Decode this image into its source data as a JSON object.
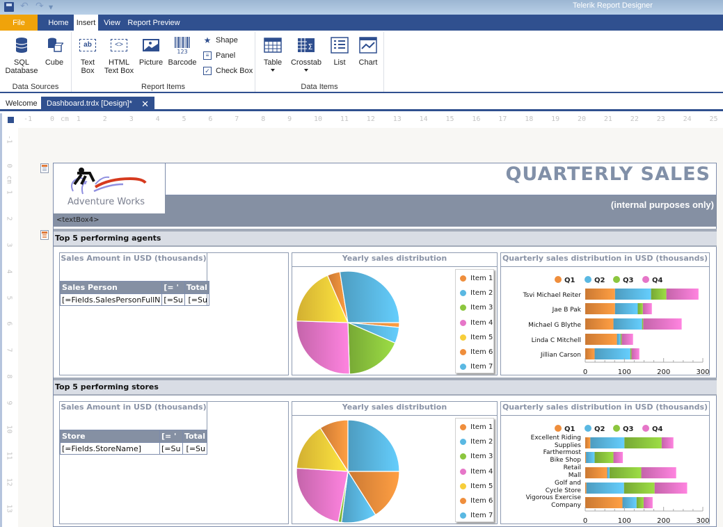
{
  "app": {
    "title": "Telerik Report Designer"
  },
  "quick_access": {
    "save": "save-icon",
    "undo": "undo-icon",
    "redo": "redo-icon",
    "more": "customize-dropdown"
  },
  "ribbon": {
    "tabs": [
      {
        "label": "File"
      },
      {
        "label": "Home"
      },
      {
        "label": "Insert"
      },
      {
        "label": "View"
      },
      {
        "label": "Report Preview"
      }
    ],
    "active_tab": "Insert",
    "groups": {
      "data_sources": {
        "label": "Data Sources",
        "buttons": [
          {
            "label1": "SQL",
            "label2": "Database"
          },
          {
            "label1": "Cube",
            "label2": ""
          }
        ]
      },
      "report_items": {
        "label": "Report Items",
        "buttons": [
          {
            "label1": "Text",
            "label2": "Box"
          },
          {
            "label1": "HTML",
            "label2": "Text Box"
          },
          {
            "label1": "Picture",
            "label2": ""
          },
          {
            "label1": "Barcode",
            "label2": ""
          }
        ],
        "small_buttons": [
          {
            "label": "Shape"
          },
          {
            "label": "Panel"
          },
          {
            "label": "Check Box"
          }
        ],
        "textbox_glyph": "ab",
        "html_glyph": "<>",
        "barcode_glyph": "123"
      },
      "data_items": {
        "label": "Data Items",
        "buttons": [
          {
            "label": "Table"
          },
          {
            "label": "Crosstab"
          },
          {
            "label": "List"
          },
          {
            "label": "Chart"
          }
        ]
      }
    }
  },
  "doc_tabs": [
    {
      "label": "Welcome"
    },
    {
      "label": "Dashboard.trdx [Design]*"
    }
  ],
  "ruler": {
    "h_labels": [
      "-1",
      "0",
      "cm",
      "1",
      "2",
      "3",
      "4",
      "5",
      "6",
      "7",
      "8",
      "9",
      "10",
      "11",
      "12",
      "13",
      "14",
      "15",
      "16",
      "17",
      "18",
      "19",
      "20",
      "21",
      "22",
      "23",
      "24",
      "25"
    ],
    "v_labels": [
      "-1",
      "0",
      "cm",
      "1",
      "2",
      "3",
      "4",
      "5",
      "6",
      "7",
      "8",
      "9",
      "10",
      "11",
      "12",
      "13"
    ]
  },
  "report": {
    "logo_text": "Adventure Works",
    "title": "QUARTERLY SALES",
    "subtitle": "(internal purposes only)",
    "textbox4": "<textBox4>",
    "sections": [
      {
        "title": "Top 5 performing agents",
        "table_title": "Sales Amount in USD (thousands)",
        "table_headers": [
          "Sales Person",
          "[= '",
          "Total"
        ],
        "table_row": [
          "[=Fields.SalesPersonFullN",
          "[=Su",
          "[=Su"
        ],
        "pie_title": "Yearly sales distribution",
        "bar_title": "Quarterly sales distribution in USD (thousands)"
      },
      {
        "title": "Top 5 performing stores",
        "table_title": "Sales Amount in USD (thousands)",
        "table_headers": [
          "Store",
          "[= '",
          "Total"
        ],
        "table_row": [
          "[=Fields.StoreName]",
          "[=Su",
          "[=Su"
        ],
        "pie_title": "Yearly sales distribution",
        "bar_title": "Quarterly sales distribution in USD (thousands)"
      }
    ]
  },
  "colors": {
    "accent": "#30508f",
    "file_tab": "#f0a30a",
    "header_band": "#8590a3",
    "title_text": "#8190a8",
    "orange": "#ef8e3c",
    "blue": "#5ab8e2",
    "green": "#8cc63e",
    "pink": "#e676c8",
    "yellow": "#f7ce3a"
  },
  "chart_data": [
    {
      "type": "pie",
      "title": "Yearly sales distribution",
      "section": "agents",
      "categories": [
        "Item 1",
        "Item 2",
        "Item 3",
        "Item 4",
        "Item 5",
        "Item 6",
        "Item 7"
      ],
      "values": [
        1.5,
        5,
        18,
        26,
        18,
        4,
        27.5
      ],
      "colors": [
        "#ef8e3c",
        "#5ab8e2",
        "#8cc63e",
        "#e676c8",
        "#f7ce3a",
        "#ef8e3c",
        "#5ab8e2"
      ],
      "legend": "right"
    },
    {
      "type": "bar",
      "orientation": "horizontal",
      "stacked": true,
      "title": "Quarterly sales distribution in USD (thousands)",
      "section": "agents",
      "categories": [
        "Tsvi Michael Reiter",
        "Jae B Pak",
        "Michael G Blythe",
        "Linda C Mitchell",
        "Jillian  Carson"
      ],
      "series": [
        {
          "name": "Q1",
          "values": [
            76,
            76,
            72,
            81,
            24
          ]
        },
        {
          "name": "Q2",
          "values": [
            92,
            58,
            73,
            9,
            91
          ]
        },
        {
          "name": "Q3",
          "values": [
            39,
            13,
            3,
            3,
            3
          ]
        },
        {
          "name": "Q4",
          "values": [
            82,
            23,
            98,
            29,
            20
          ]
        }
      ],
      "xlim": [
        0,
        300
      ],
      "xticks": [
        "0",
        "100",
        "200",
        "300"
      ],
      "legend": "top"
    },
    {
      "type": "pie",
      "title": "Yearly sales distribution",
      "section": "stores",
      "categories": [
        "Item 1",
        "Item 2",
        "Item 3",
        "Item 4",
        "Item 5",
        "Item 6",
        "Item 7"
      ],
      "values": [
        16,
        11,
        1,
        23,
        15,
        9,
        25
      ],
      "colors": [
        "#ef8e3c",
        "#5ab8e2",
        "#8cc63e",
        "#e676c8",
        "#f7ce3a",
        "#ef8e3c",
        "#5ab8e2"
      ],
      "legend": "right"
    },
    {
      "type": "bar",
      "orientation": "horizontal",
      "stacked": true,
      "title": "Quarterly sales distribution in USD (thousands)",
      "section": "stores",
      "categories": [
        "Excellent Riding Supplies",
        "Farthermost Bike Shop",
        "Retail Mall",
        "Golf and Cycle Store",
        "Vigorous Exercise Company"
      ],
      "category_lines": [
        [
          "Excellent Riding",
          "Supplies"
        ],
        [
          "Farthermost",
          "Bike Shop"
        ],
        [
          "Retail",
          "Mall"
        ],
        [
          "Golf and",
          "Cycle Store"
        ],
        [
          "Vigorous Exercise",
          "Company"
        ]
      ],
      "series": [
        {
          "name": "Q1",
          "values": [
            13,
            2,
            56,
            3,
            95
          ]
        },
        {
          "name": "Q2",
          "values": [
            87,
            22,
            6,
            96,
            36
          ]
        },
        {
          "name": "Q3",
          "values": [
            95,
            48,
            81,
            78,
            18
          ]
        },
        {
          "name": "Q4",
          "values": [
            30,
            24,
            89,
            83,
            23
          ]
        }
      ],
      "xlim": [
        0,
        300
      ],
      "xticks": [
        "0",
        "100",
        "200",
        "300"
      ],
      "legend": "top"
    }
  ]
}
